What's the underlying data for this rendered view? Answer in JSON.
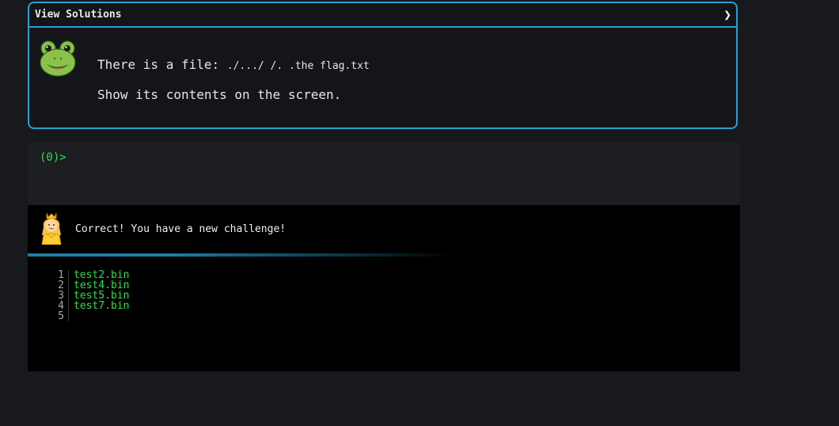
{
  "panel": {
    "title": "View Solutions",
    "toggle_icon": "chevron-right-icon",
    "avatar_icon": "frog-face-icon",
    "intro_text": "There is a file: ",
    "file_path": "./.../ /. .the flag.txt",
    "instruction": "Show its contents on the screen."
  },
  "terminal": {
    "prompt": "(0)>",
    "input_value": ""
  },
  "output": {
    "avatar_icon": "princess-icon",
    "message": "Correct! You have a new challenge!",
    "progress_fraction": 0.6,
    "progress_color": "#1a7fa5",
    "lines": [
      {
        "num": "1",
        "text": "test2.bin"
      },
      {
        "num": "2",
        "text": "test4.bin"
      },
      {
        "num": "3",
        "text": "test5.bin"
      },
      {
        "num": "4",
        "text": "test7.bin"
      },
      {
        "num": "5",
        "text": ""
      }
    ]
  },
  "colors": {
    "accent_border": "#2b9fd0",
    "terminal_green": "#2ee04a",
    "background": "#18191c"
  }
}
